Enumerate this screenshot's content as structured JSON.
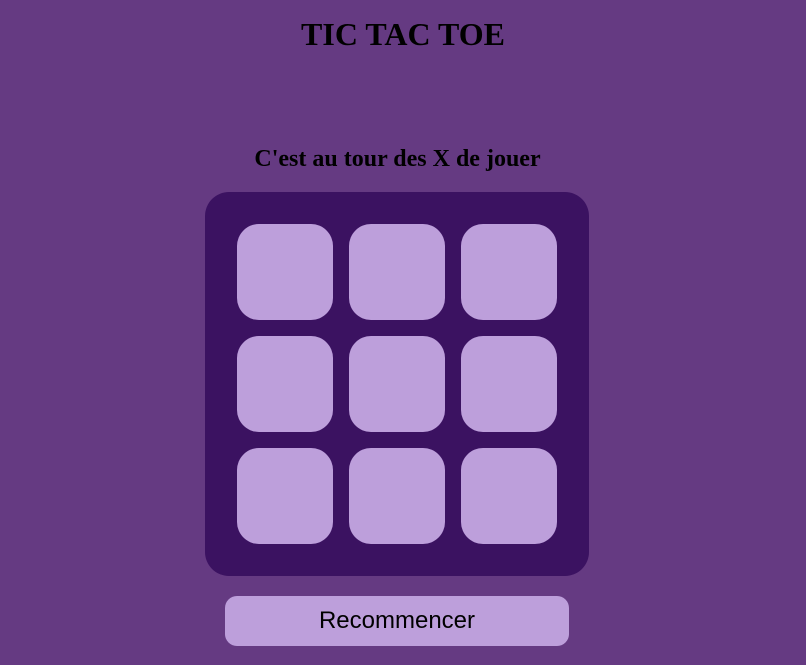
{
  "game": {
    "title": "TIC TAC TOE",
    "status": "C'est au tour des X de jouer",
    "current_player": "X",
    "board": [
      "",
      "",
      "",
      "",
      "",
      "",
      "",
      "",
      ""
    ],
    "restart_label": "Recommencer"
  },
  "colors": {
    "background": "#653a82",
    "board": "#3b1261",
    "cell": "#bd9fdb",
    "text": "#000000"
  }
}
